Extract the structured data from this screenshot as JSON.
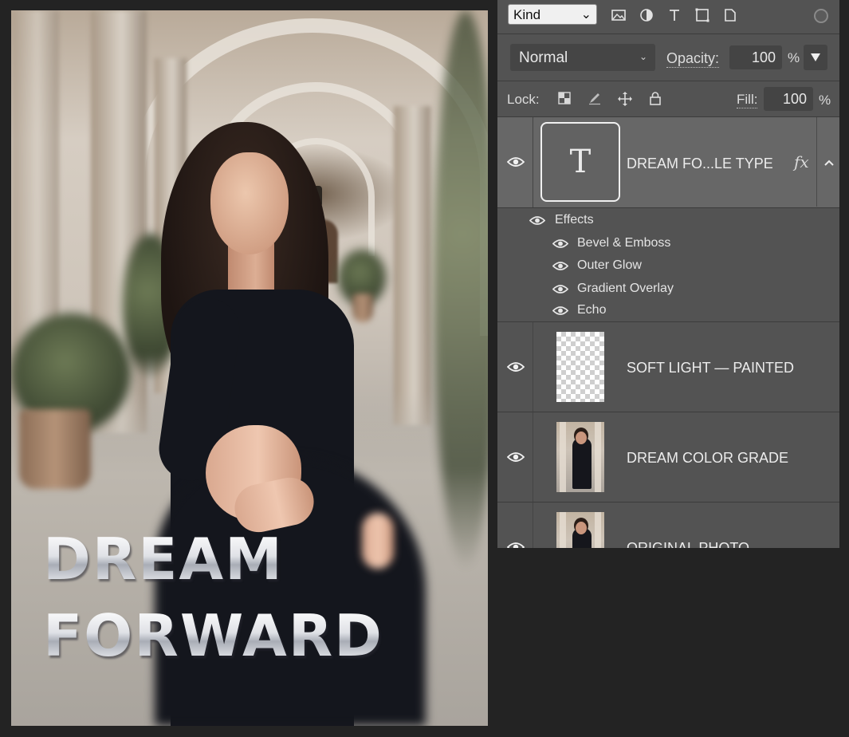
{
  "canvas": {
    "title_line1": "DREAM",
    "title_line2": "FORWARD"
  },
  "layers_panel": {
    "filter": {
      "kind_label": "Kind",
      "icons": [
        "image-filter-icon",
        "adjustment-filter-icon",
        "type-filter-icon",
        "shape-filter-icon",
        "smart-object-filter-icon"
      ]
    },
    "blend_mode": "Normal",
    "opacity_label": "Opacity:",
    "opacity_value": "100",
    "percent": "%",
    "lock_label": "Lock:",
    "fill_label": "Fill:",
    "fill_value": "100",
    "layers": [
      {
        "name": "DREAM FO...LE TYPE",
        "type": "text",
        "thumb_glyph": "T",
        "fx": "fx",
        "selected": true
      },
      {
        "name": "SOFT LIGHT — PAINTED",
        "type": "transparent"
      },
      {
        "name": "DREAM COLOR GRADE",
        "type": "photo"
      },
      {
        "name": "ORIGINAL PHOTO",
        "type": "photo"
      }
    ],
    "effects": {
      "header": "Effects",
      "items": [
        "Bevel & Emboss",
        "Outer Glow",
        "Gradient Overlay",
        "Echo"
      ]
    }
  },
  "colors": {
    "app_background": "#232323",
    "panel_background": "#535353",
    "selected_layer": "#676767"
  }
}
